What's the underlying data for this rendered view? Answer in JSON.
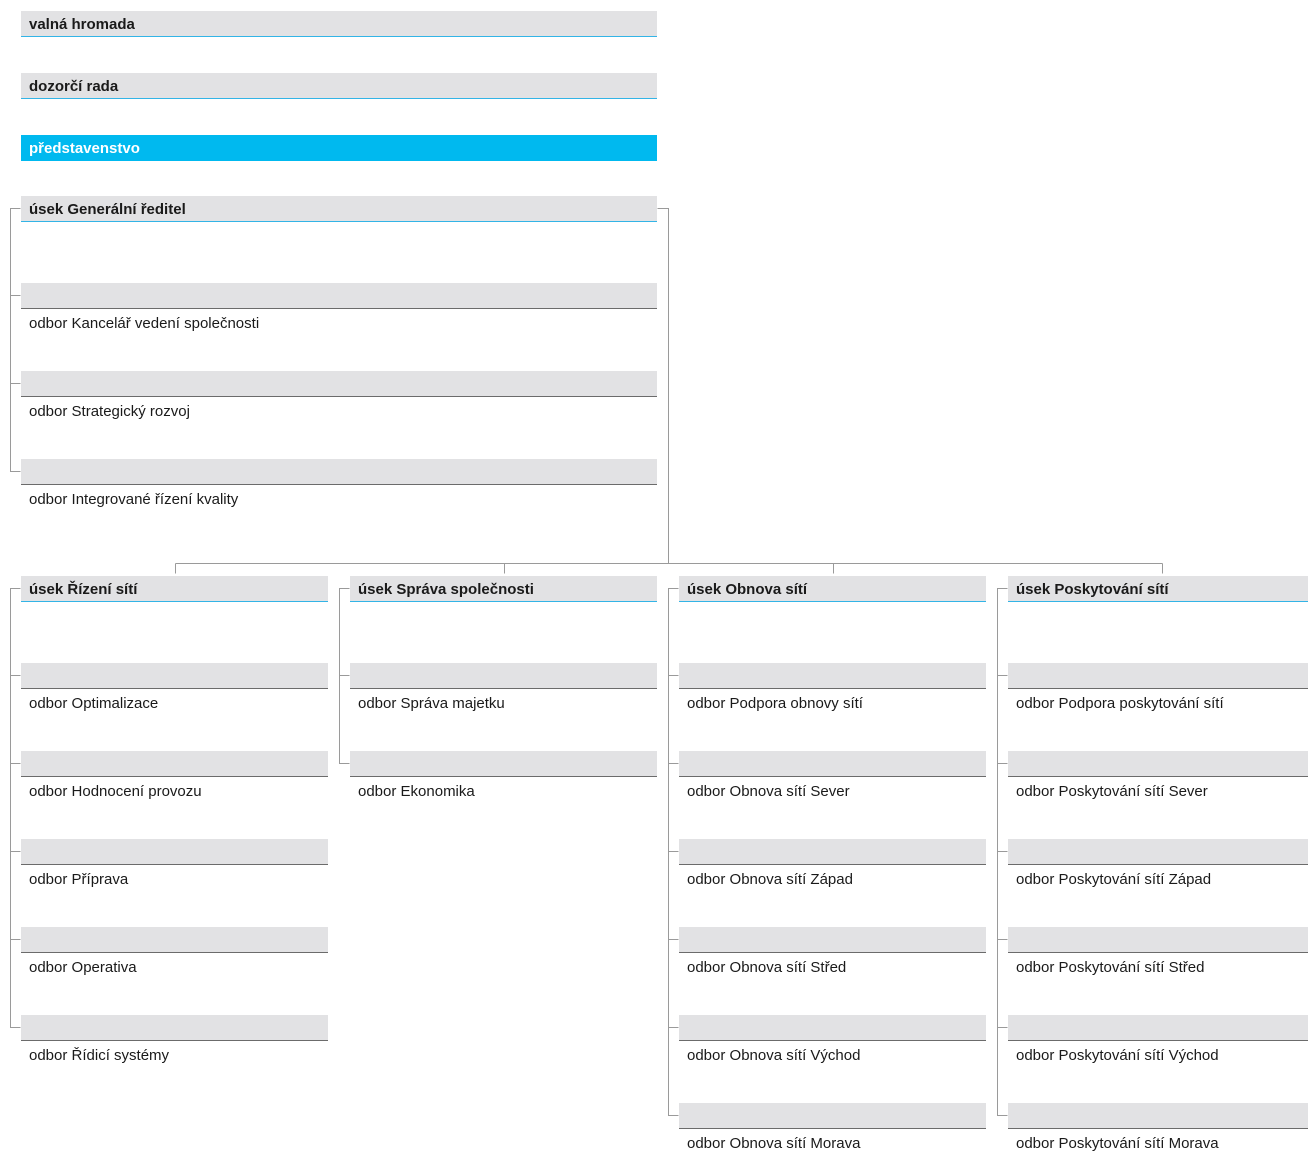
{
  "board": {
    "general_meeting": "valná hromada",
    "supervisory_board": "dozorčí rada",
    "board_of_directors": "představenstvo"
  },
  "colors": {
    "accent": "#00b9ef",
    "bar": "#e2e2e4",
    "connector": "#9a9a9a"
  },
  "ceo_division": {
    "title": "úsek Generální ředitel",
    "departments": [
      "odbor Kancelář vedení společnosti",
      "odbor Strategický rozvoj",
      "odbor Integrované řízení kvality"
    ]
  },
  "divisions": [
    {
      "title": "úsek Řízení sítí",
      "departments": [
        "odbor Optimalizace",
        "odbor Hodnocení provozu",
        "odbor Příprava",
        "odbor Operativa",
        "odbor Řídicí systémy"
      ]
    },
    {
      "title": "úsek Správa společnosti",
      "departments": [
        "odbor Správa majetku",
        "odbor Ekonomika"
      ]
    },
    {
      "title": "úsek Obnova sítí",
      "departments": [
        "odbor Podpora obnovy sítí",
        "odbor Obnova sítí Sever",
        "odbor Obnova sítí Západ",
        "odbor Obnova sítí Střed",
        "odbor Obnova sítí Východ",
        "odbor Obnova sítí Morava"
      ]
    },
    {
      "title": "úsek Poskytování sítí",
      "departments": [
        "odbor Podpora poskytování sítí",
        "odbor Poskytování sítí Sever",
        "odbor Poskytování sítí Západ",
        "odbor Poskytování sítí Střed",
        "odbor Poskytování sítí Východ",
        "odbor Poskytování sítí Morava"
      ]
    }
  ]
}
